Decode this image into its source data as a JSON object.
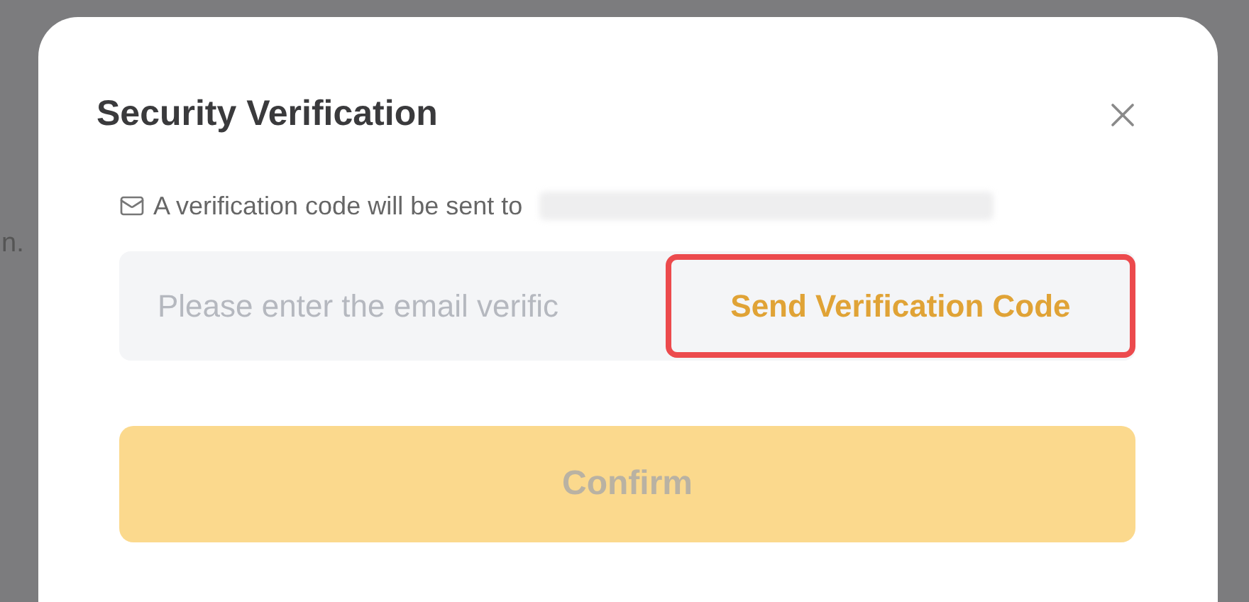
{
  "background": {
    "text": "n."
  },
  "dialog": {
    "title": "Security Verification",
    "info": "A verification code will be sent to",
    "email_redacted": true,
    "code_field": {
      "placeholder": "Please enter the email verific"
    },
    "send_button": {
      "label": "Send Verification Code",
      "highlighted": true
    },
    "confirm_button": {
      "label": "Confirm",
      "disabled": true
    }
  }
}
